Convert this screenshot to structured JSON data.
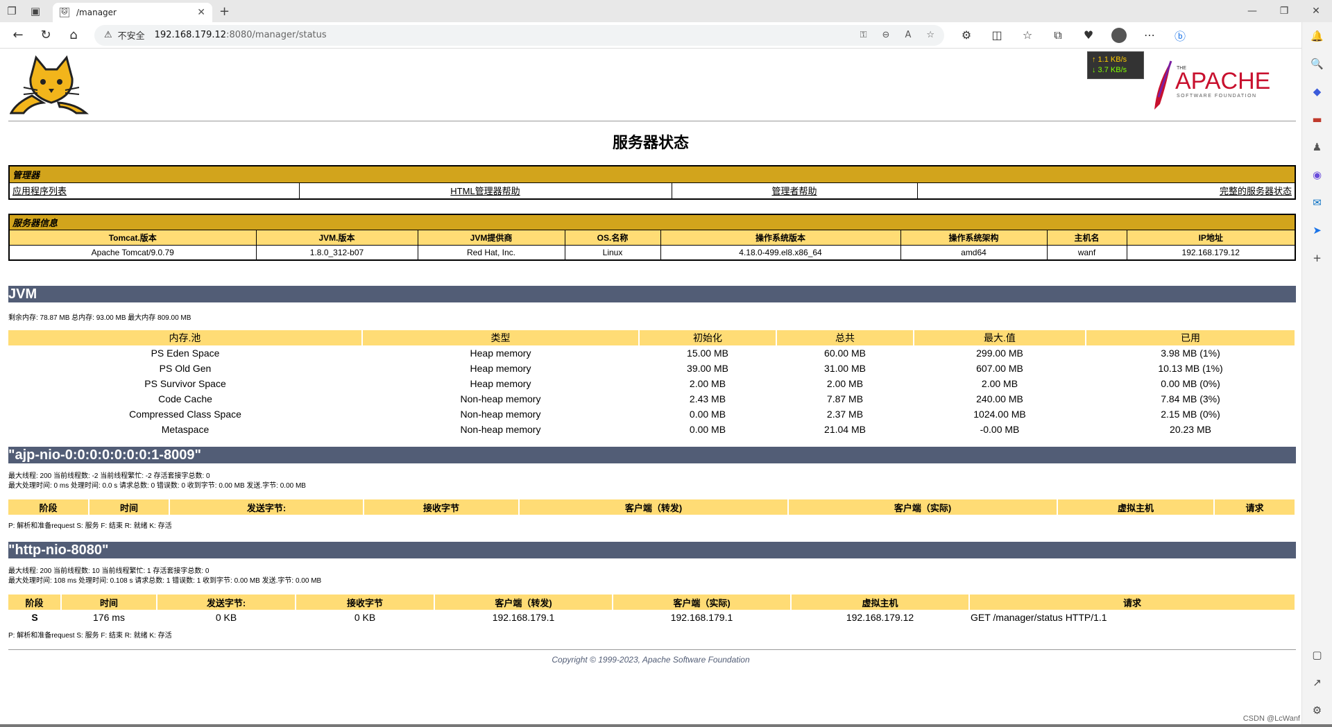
{
  "browser": {
    "tab_title": "/manager",
    "url_warning": "不安全",
    "url_host": "192.168.179.12",
    "url_path": ":8080/manager/status"
  },
  "netspeed": {
    "up": "↑ 1.1 KB/s",
    "down": "↓ 3.7 KB/s"
  },
  "apache_logo": {
    "the": "THE",
    "name": "APACHE",
    "sub": "SOFTWARE FOUNDATION"
  },
  "page_title": "服务器状态",
  "manager": {
    "header": "管理器",
    "links": [
      "应用程序列表",
      "HTML管理器帮助",
      "管理者帮助",
      "完整的服务器状态"
    ]
  },
  "server_info": {
    "header": "服务器信息",
    "columns": [
      "Tomcat.版本",
      "JVM.版本",
      "JVM提供商",
      "OS.名称",
      "操作系统版本",
      "操作系统架构",
      "主机名",
      "IP地址"
    ],
    "values": [
      "Apache Tomcat/9.0.79",
      "1.8.0_312-b07",
      "Red Hat, Inc.",
      "Linux",
      "4.18.0-499.el8.x86_64",
      "amd64",
      "wanf",
      "192.168.179.12"
    ]
  },
  "jvm": {
    "title": "JVM",
    "memory_line": "剩余内存:  78.87 MB 总内存:  93.00 MB 最大内存 809.00 MB",
    "pool_columns": [
      "内存.池",
      "类型",
      "初始化",
      "总共",
      "最大.值",
      "已用"
    ],
    "pools": [
      [
        "PS Eden Space",
        "Heap memory",
        "15.00 MB",
        "60.00 MB",
        "299.00 MB",
        "3.98 MB (1%)"
      ],
      [
        "PS Old Gen",
        "Heap memory",
        "39.00 MB",
        "31.00 MB",
        "607.00 MB",
        "10.13 MB (1%)"
      ],
      [
        "PS Survivor Space",
        "Heap memory",
        "2.00 MB",
        "2.00 MB",
        "2.00 MB",
        "0.00 MB (0%)"
      ],
      [
        "Code Cache",
        "Non-heap memory",
        "2.43 MB",
        "7.87 MB",
        "240.00 MB",
        "7.84 MB (3%)"
      ],
      [
        "Compressed Class Space",
        "Non-heap memory",
        "0.00 MB",
        "2.37 MB",
        "1024.00 MB",
        "2.15 MB (0%)"
      ],
      [
        "Metaspace",
        "Non-heap memory",
        "0.00 MB",
        "21.04 MB",
        "-0.00 MB",
        "20.23 MB"
      ]
    ]
  },
  "ajp": {
    "title": "\"ajp-nio-0:0:0:0:0:0:0:1-8009\"",
    "line1": "最大线程:  200 当前线程数:  -2 当前线程繁忙:  -2 存活套接字总数:  0",
    "line2": "最大处理时间:  0 ms 处理时间:  0.0 s 请求总数:  0 错误数:  0 收到字节:  0.00 MB 发送.字节: 0.00 MB",
    "columns": [
      "阶段",
      "时间",
      "发送字节:",
      "接收字节",
      "客户端（转发)",
      "客户端（实际)",
      "虚拟主机",
      "请求"
    ],
    "legend": "P: 解析和准备request S: 服务 F: 结束 R: 就绪 K: 存活"
  },
  "http": {
    "title": "\"http-nio-8080\"",
    "line1": "最大线程:  200 当前线程数:  10 当前线程繁忙:  1 存活套接字总数:  0",
    "line2": "最大处理时间:  108 ms 处理时间:  0.108 s 请求总数:  1 错误数:  1 收到字节:  0.00 MB 发送.字节: 0.00 MB",
    "columns": [
      "阶段",
      "时间",
      "发送字节:",
      "接收字节",
      "客户端（转发)",
      "客户端（实际)",
      "虚拟主机",
      "请求"
    ],
    "row": [
      "S",
      "176 ms",
      "0 KB",
      "0 KB",
      "192.168.179.1",
      "192.168.179.1",
      "192.168.179.12",
      "GET /manager/status HTTP/1.1"
    ],
    "legend": "P: 解析和准备request S: 服务 F: 结束 R: 就绪 K: 存活"
  },
  "copyright": "Copyright © 1999-2023, Apache Software Foundation",
  "watermark": "CSDN @LcWanf"
}
